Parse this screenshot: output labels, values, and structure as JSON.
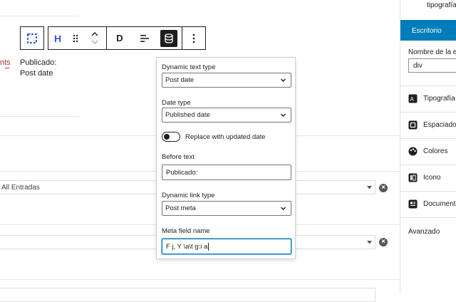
{
  "content": {
    "fragment_text": "nts",
    "meta_label": "Publicado:",
    "meta_value": "Post date"
  },
  "query_loop": {
    "post_type_value": "All Entradas",
    "second_select_value": ""
  },
  "popover": {
    "dynamic_text_type_label": "Dynamic text type",
    "dynamic_text_type_value": "Post date",
    "date_type_label": "Date type",
    "date_type_value": "Published date",
    "replace_toggle_label": "Replace with updated date",
    "replace_toggle_on": false,
    "before_text_label": "Before text",
    "before_text_value": "Publicado:",
    "dynamic_link_type_label": "Dynamic link type",
    "dynamic_link_type_value": "Post meta",
    "meta_field_name_label": "Meta field name",
    "meta_field_name_value": "F j, Y \\a\\t g:i a"
  },
  "toolbar": {
    "heading_button": "H",
    "dynamic_button": "D"
  },
  "sidebar": {
    "top_label": "tipografía",
    "device_tab": "Escritorio",
    "tag_name_label": "Nombre de la eti",
    "tag_name_value": "div",
    "items": [
      {
        "label": "Tipografía",
        "icon": "typography-icon"
      },
      {
        "label": "Espaciado",
        "icon": "spacing-icon"
      },
      {
        "label": "Colores",
        "icon": "palette-icon"
      },
      {
        "label": "Icono",
        "icon": "icon-panel-icon"
      },
      {
        "label": "Documenta",
        "icon": "document-icon"
      }
    ],
    "advanced_label": "Avanzado",
    "accent_color": "#007cba"
  }
}
